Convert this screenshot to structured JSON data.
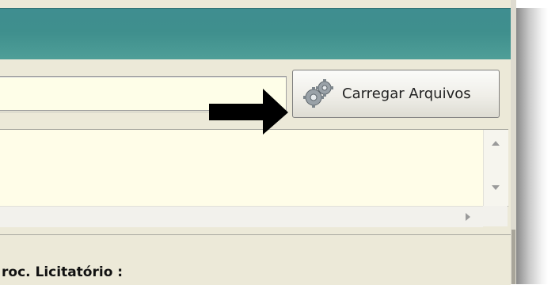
{
  "toolbar": {
    "load_button_label": "Carregar Arquivos",
    "load_button_icon": "gears-icon",
    "file_path_value": ""
  },
  "annotation": {
    "arrow_icon": "arrow-right-icon",
    "arrow_color": "#000000"
  },
  "text_area": {
    "content": ""
  },
  "form": {
    "proc_label": "roc. Licitatório :"
  },
  "colors": {
    "title_bar": "#3f8e90",
    "input_background": "#fefee8",
    "panel_background": "#ece9d8"
  }
}
